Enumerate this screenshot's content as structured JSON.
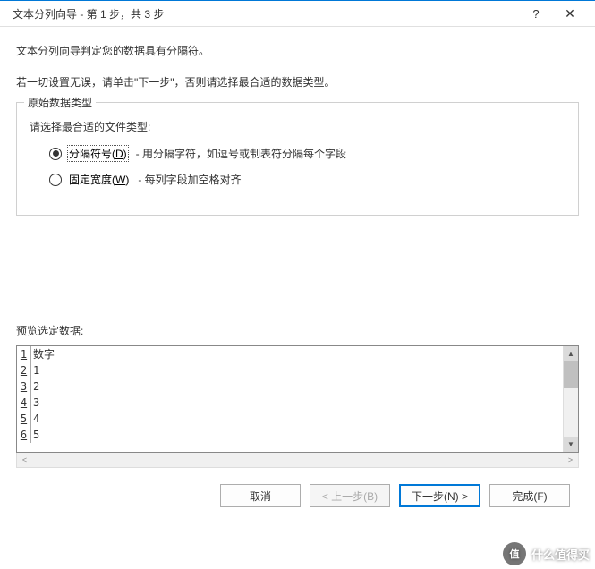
{
  "title": "文本分列向导 - 第 1 步，共 3 步",
  "intro1": "文本分列向导判定您的数据具有分隔符。",
  "intro2": "若一切设置无误，请单击\"下一步\"，否则请选择最合适的数据类型。",
  "group": {
    "legend": "原始数据类型",
    "subtitle": "请选择最合适的文件类型:",
    "options": [
      {
        "label": "分隔符号(",
        "shortcut": "D",
        "label_after": ")",
        "desc": "- 用分隔字符，如逗号或制表符分隔每个字段",
        "checked": true
      },
      {
        "label": "固定宽度(",
        "shortcut": "W",
        "label_after": ")",
        "desc": "- 每列字段加空格对齐",
        "checked": false
      }
    ]
  },
  "preview": {
    "label": "预览选定数据:",
    "rows": [
      {
        "num": "1",
        "value": "数字"
      },
      {
        "num": "2",
        "value": "1"
      },
      {
        "num": "3",
        "value": "2"
      },
      {
        "num": "4",
        "value": "3"
      },
      {
        "num": "5",
        "value": "4"
      },
      {
        "num": "6",
        "value": "5"
      }
    ]
  },
  "buttons": {
    "cancel": "取消",
    "back": "< 上一步(B)",
    "next": "下一步(N) >",
    "finish": "完成(F)"
  },
  "watermark": "什么值得买"
}
